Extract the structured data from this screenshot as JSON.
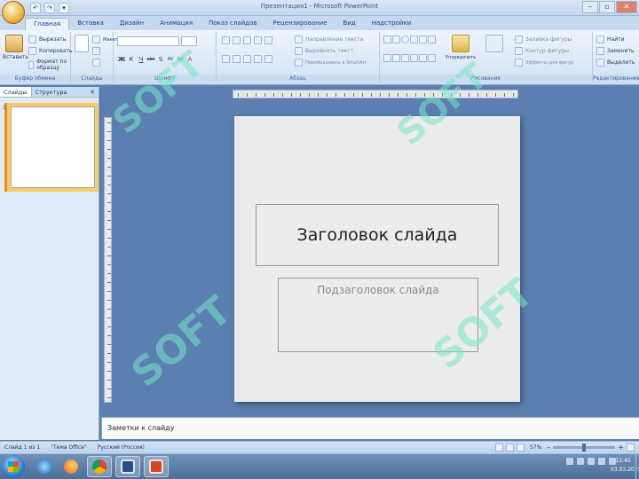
{
  "window": {
    "title": "Презентация1 - Microsoft PowerPoint",
    "office_button_letter": "a",
    "qat": [
      "↶",
      "↷",
      "▾"
    ],
    "controls": [
      "–",
      "▫",
      "✕"
    ]
  },
  "tabs": [
    "Главная",
    "Вставка",
    "Дизайн",
    "Анимация",
    "Показ слайдов",
    "Рецензирование",
    "Вид",
    "Надстройки"
  ],
  "ribbon": {
    "clipboard": {
      "label": "Буфер обмена",
      "paste": "Вставить",
      "cut": "Вырезать",
      "copy": "Копировать",
      "format": "Формат по образцу"
    },
    "slides": {
      "label": "Слайды",
      "new_slide": "Создать слайд",
      "layout": "Макет",
      "reset": "Восстановить",
      "delete": "Удалить"
    },
    "font": {
      "label": "Шрифт",
      "format_buttons": [
        "Ж",
        "К",
        "Ч",
        "abc",
        "S",
        "AV",
        "Aa",
        "A"
      ]
    },
    "paragraph": {
      "label": "Абзац",
      "text_direction": "Направление текста",
      "align_text": "Выровнять текст",
      "smartart": "Преобразовать в SmartArt"
    },
    "drawing": {
      "label": "Рисование",
      "arrange": "Упорядочить",
      "quick_styles": "Экспресс-стили",
      "fill": "Заливка фигуры",
      "outline": "Контур фигуры",
      "effects": "Эффекты для фигур"
    },
    "editing": {
      "label": "Редактирование",
      "find": "Найти",
      "replace": "Заменить",
      "select": "Выделить"
    }
  },
  "left_pane": {
    "tabs": [
      "Слайды",
      "Структура"
    ],
    "close": "✕",
    "slide_number": "1"
  },
  "slide": {
    "title": "Заголовок слайда",
    "subtitle": "Подзаголовок слайда"
  },
  "notes": {
    "text": "Заметки к слайду"
  },
  "statusbar": {
    "slide_info": "Слайд 1 из 1",
    "theme": "\"Тема Office\"",
    "language": "Русский (Россия)",
    "zoom": "57%",
    "zoom_fraction": 0.5
  },
  "taskbar": {
    "clock_time": "13:45",
    "clock_date": "03.03.2015"
  },
  "watermark": {
    "text": "SOFT"
  }
}
